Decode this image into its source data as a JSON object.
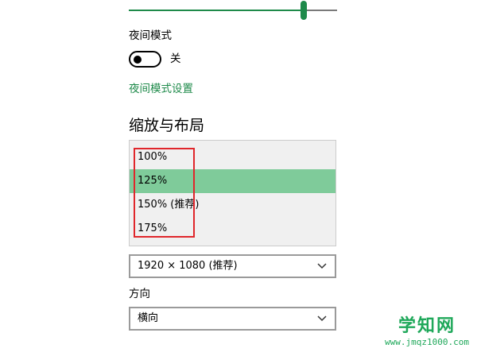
{
  "brightness": {
    "level_fraction": 0.84,
    "accent_color": "#1e8a4a"
  },
  "night_mode": {
    "label": "夜间模式",
    "toggle_state_label": "关",
    "is_on": false,
    "settings_link": "夜间模式设置"
  },
  "scale_layout": {
    "title": "缩放与布局",
    "scale_options": [
      "100%",
      "125%",
      "150% (推荐)",
      "175%"
    ],
    "selected_index": 1,
    "selected_color": "#7fcb9a",
    "highlight_color": "#e0262b",
    "resolution": {
      "value": "1920 × 1080 (推荐)",
      "icon": "chevron-down-icon"
    },
    "orientation": {
      "label": "方向",
      "value": "横向",
      "icon": "chevron-down-icon"
    }
  },
  "watermark": {
    "main": "学知网",
    "sub": "www.jmqz1000.com",
    "color": "#1fa85a"
  }
}
